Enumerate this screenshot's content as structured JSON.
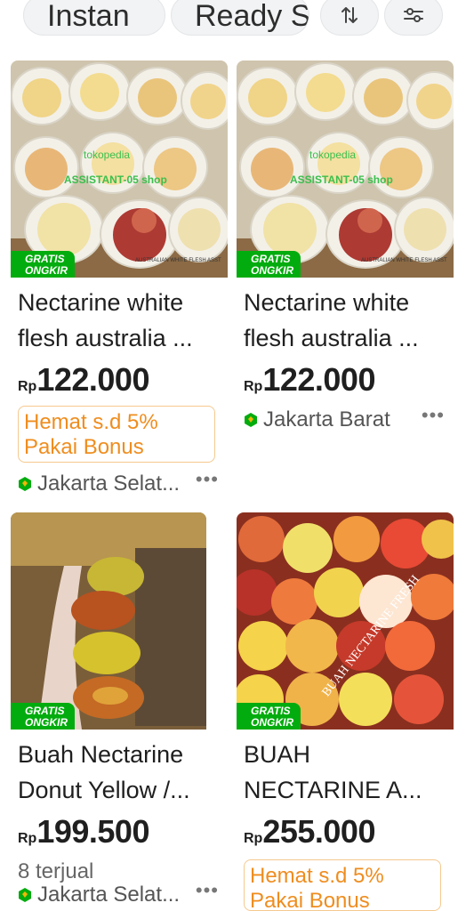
{
  "filters": {
    "chip1": "Instan",
    "chip2": "Ready S",
    "sort_icon": "sort-icon",
    "filter_icon": "filter-sliders-icon"
  },
  "products": [
    {
      "title": "Nectarine white\nflesh australia ...",
      "badge": "GRATIS\nONGKIR",
      "currency": "Rp",
      "price": "122.000",
      "promo": "Hemat s.d 5%\nPakai Bonus",
      "location": "Jakarta Selat...",
      "watermark_1": "tokopedia",
      "watermark_2": "ASSISTANT-05 shop",
      "box_text": "AUSTRALIAN WHITE FLESH ASST"
    },
    {
      "title": "Nectarine white\nflesh australia ...",
      "badge": "GRATIS\nONGKIR",
      "currency": "Rp",
      "price": "122.000",
      "location": "Jakarta Barat",
      "watermark_1": "tokopedia",
      "watermark_2": "ASSISTANT-05 shop",
      "box_text": "AUSTRALIAN WHITE FLESH ASST"
    },
    {
      "title": "Buah Nectarine\nDonut Yellow /...",
      "badge": "GRATIS\nONGKIR",
      "currency": "Rp",
      "price": "199.500",
      "sold": "8 terjual",
      "location": "Jakarta Selat..."
    },
    {
      "title": "BUAH\nNECTARINE A...",
      "badge": "GRATIS\nONGKIR",
      "currency": "Rp",
      "price": "255.000",
      "promo": "Hemat s.d 5%\nPakai Bonus",
      "watermark": "BUAH NECTARINE FRESH"
    }
  ],
  "more_icon": "more-dots-icon",
  "colors": {
    "green_badge": "#03ac0e",
    "promo_orange": "#ef8d1f",
    "shop_badge": "#f2b705"
  }
}
